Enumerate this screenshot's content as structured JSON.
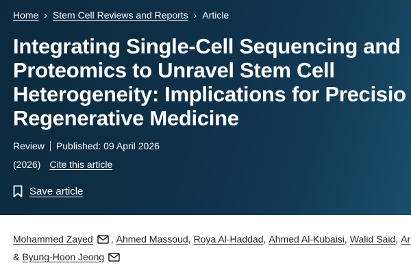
{
  "breadcrumb": {
    "items": [
      "Home",
      "Stem Cell Reviews and Reports"
    ],
    "current": "Article"
  },
  "article": {
    "title_lines": [
      "Integrating Single-Cell Sequencing and",
      "Proteomics to Unravel Stem Cell",
      "Heterogeneity: Implications for Precisio",
      "Regenerative Medicine"
    ],
    "type": "Review",
    "published": "Published: 09 April 2026",
    "year": "(2026)",
    "cite_label": "Cite this article",
    "save_label": "Save article"
  },
  "authors": {
    "line1": [
      "Mohammed Zayed",
      "Ahmed Massoud",
      "Roya Al-Haddad",
      "Ahmed Al-Kubaisi",
      "Walid Said",
      "Ar"
    ],
    "line2_prefix": "&",
    "line2": [
      "Byung-Hoon Jeong"
    ]
  },
  "icons": {
    "separator": "chevron-right-icon",
    "save": "bookmark-icon",
    "email": "envelope-icon"
  },
  "colors": {
    "hero_background": "#0e3048",
    "text_on_hero": "#ffffff",
    "body_text": "#222222"
  }
}
